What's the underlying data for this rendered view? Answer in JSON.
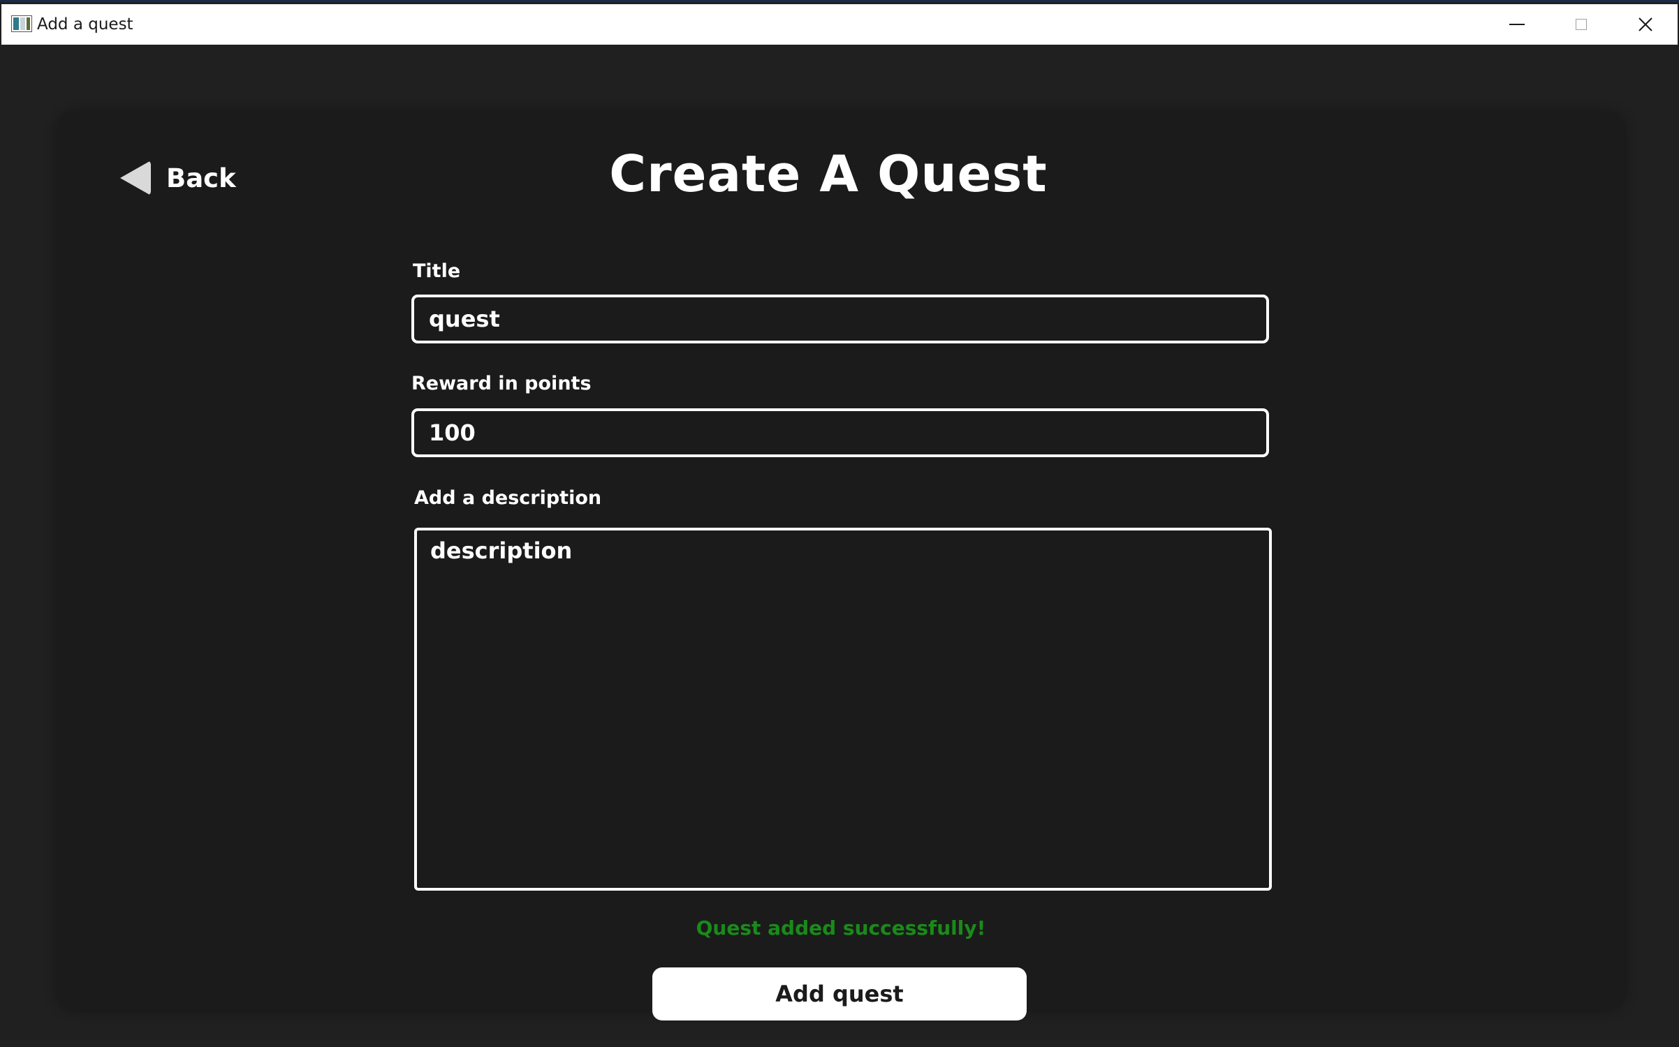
{
  "window": {
    "title": "Add a quest",
    "controls": {
      "minimize": "minimize-icon",
      "maximize": "maximize-icon",
      "close": "close-icon"
    }
  },
  "nav": {
    "back_label": "Back"
  },
  "page": {
    "title": "Create A Quest"
  },
  "form": {
    "title_label": "Title",
    "title_value": "quest",
    "reward_label": "Reward in points",
    "reward_value": "100",
    "description_label": "Add a description",
    "description_value": "description"
  },
  "status": {
    "message": "Quest added successfully!",
    "color": "#1a8a1a"
  },
  "actions": {
    "submit_label": "Add quest"
  },
  "colors": {
    "background": "#202020",
    "panel": "#1b1b1b",
    "text": "#ffffff",
    "success": "#1a8a1a"
  }
}
